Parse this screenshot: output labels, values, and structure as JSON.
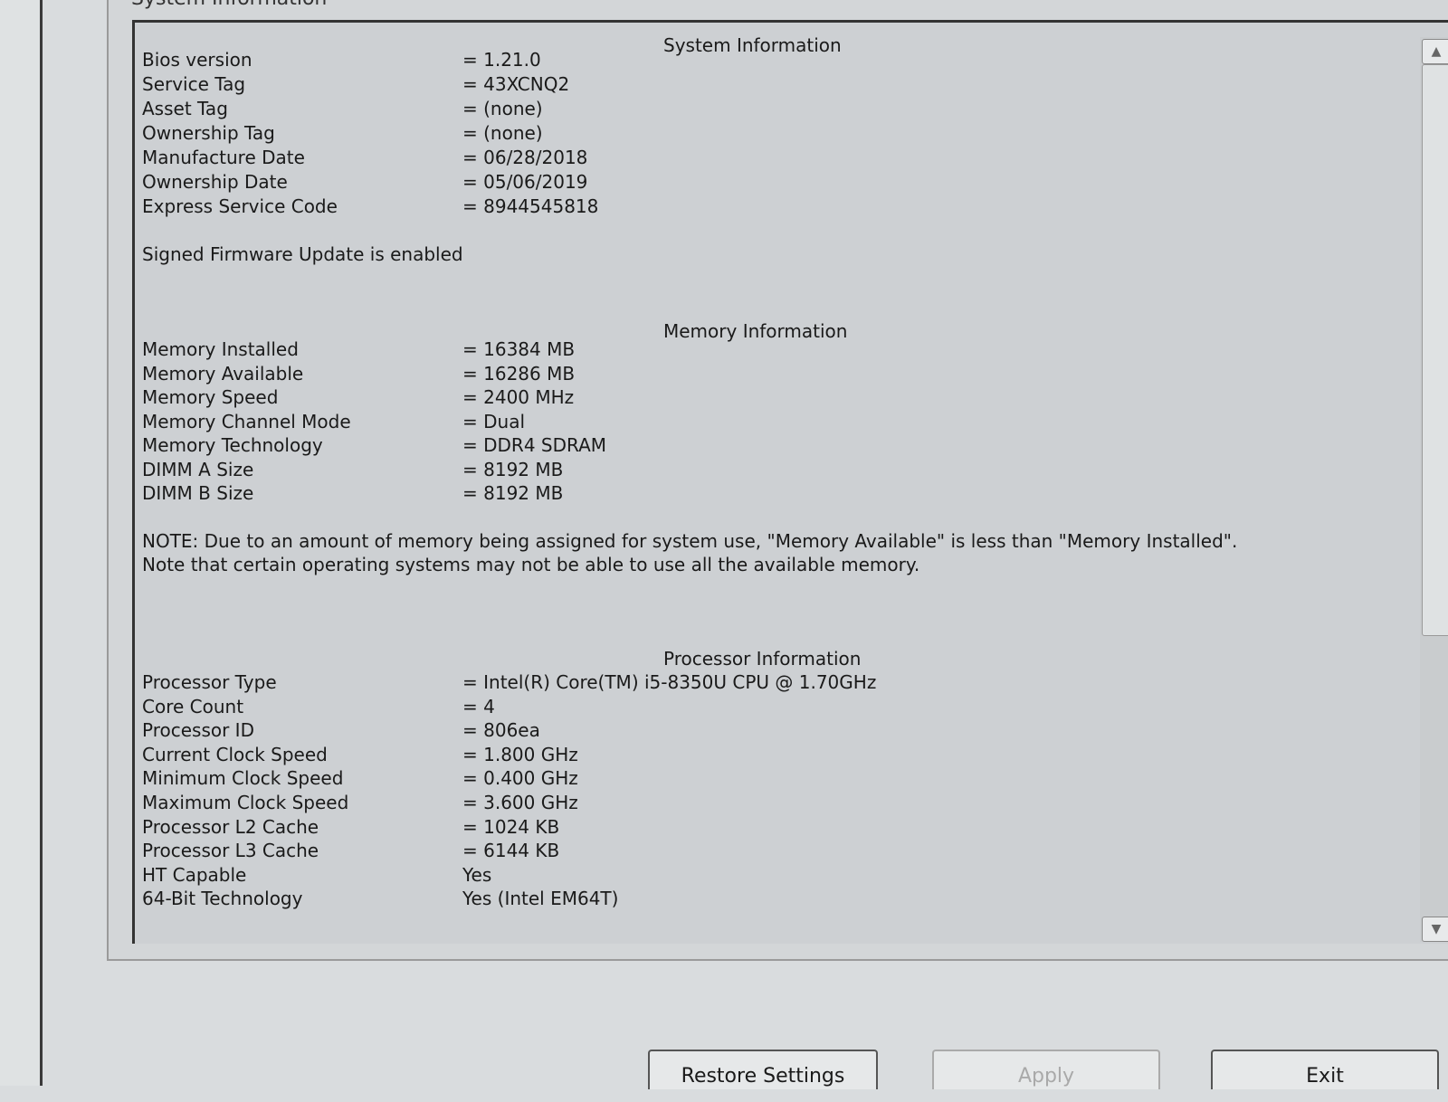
{
  "frame_title": "System Information",
  "system": {
    "title": "System Information",
    "rows": [
      {
        "label": "Bios version",
        "value": "= 1.21.0"
      },
      {
        "label": "Service Tag",
        "value": "= 43XCNQ2"
      },
      {
        "label": "Asset Tag",
        "value": "= (none)"
      },
      {
        "label": "Ownership Tag",
        "value": "= (none)"
      },
      {
        "label": "Manufacture Date",
        "value": "= 06/28/2018"
      },
      {
        "label": "Ownership Date",
        "value": "= 05/06/2019"
      },
      {
        "label": "Express Service Code",
        "value": "= 8944545818"
      }
    ],
    "firmware_note": "Signed Firmware Update is enabled"
  },
  "memory": {
    "title": "Memory Information",
    "rows": [
      {
        "label": "Memory Installed",
        "value": "= 16384 MB"
      },
      {
        "label": "Memory Available",
        "value": "= 16286 MB"
      },
      {
        "label": "Memory Speed",
        "value": "= 2400 MHz"
      },
      {
        "label": "Memory Channel Mode",
        "value": "= Dual"
      },
      {
        "label": "Memory Technology",
        "value": "= DDR4 SDRAM"
      },
      {
        "label": "DIMM A Size",
        "value": "= 8192 MB"
      },
      {
        "label": "DIMM B Size",
        "value": "= 8192 MB"
      }
    ],
    "note": "NOTE: Due to an amount of memory being assigned for system use, \"Memory Available\" is less than \"Memory Installed\". Note that certain operating systems may not be able to use all the available memory."
  },
  "processor": {
    "title": "Processor Information",
    "rows": [
      {
        "label": "Processor Type",
        "value": "= Intel(R) Core(TM) i5-8350U CPU @ 1.70GHz"
      },
      {
        "label": "Core Count",
        "value": "= 4"
      },
      {
        "label": "Processor ID",
        "value": "= 806ea"
      },
      {
        "label": "Current Clock Speed",
        "value": "= 1.800 GHz"
      },
      {
        "label": "Minimum Clock Speed",
        "value": "= 0.400 GHz"
      },
      {
        "label": "Maximum Clock Speed",
        "value": "= 3.600 GHz"
      },
      {
        "label": "Processor L2 Cache",
        "value": "= 1024 KB"
      },
      {
        "label": "Processor L3 Cache",
        "value": "= 6144 KB"
      },
      {
        "label": "HT Capable",
        "value": "Yes"
      },
      {
        "label": "64-Bit Technology",
        "value": "Yes (Intel EM64T)"
      }
    ]
  },
  "buttons": {
    "restore": "Restore Settings",
    "apply": "Apply",
    "exit": "Exit"
  },
  "scroll": {
    "up": "▲",
    "down": "▼"
  }
}
